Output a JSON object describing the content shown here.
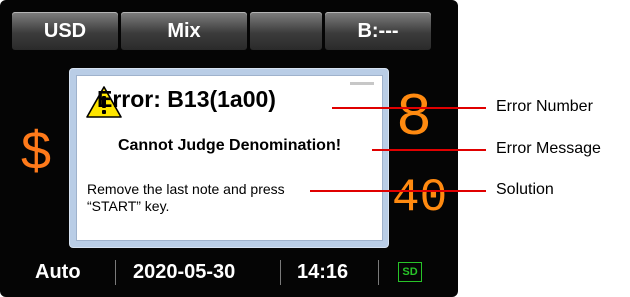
{
  "topbar": {
    "tabs": [
      "USD",
      "Mix",
      "",
      "B:---"
    ]
  },
  "display": {
    "currency_symbol": "$",
    "count_value": "8",
    "amount_value": "40"
  },
  "dialog": {
    "title": "Error: B13(1a00)",
    "message": "Cannot Judge Denomination!",
    "solution_line1": "Remove the last note and press",
    "solution_line2": "“START” key."
  },
  "bottombar": {
    "mode": "Auto",
    "date": "2020-05-30",
    "time": "14:16",
    "sd_label": "SD"
  },
  "callouts": {
    "error_number": "Error Number",
    "error_message": "Error Message",
    "solution": "Solution"
  },
  "colors": {
    "accent_orange": "#ff8a10",
    "callout_red": "#e00000",
    "sd_green": "#28c428"
  },
  "icons": {
    "warning": "warning-triangle-icon",
    "sd_card": "sd-card-icon"
  }
}
